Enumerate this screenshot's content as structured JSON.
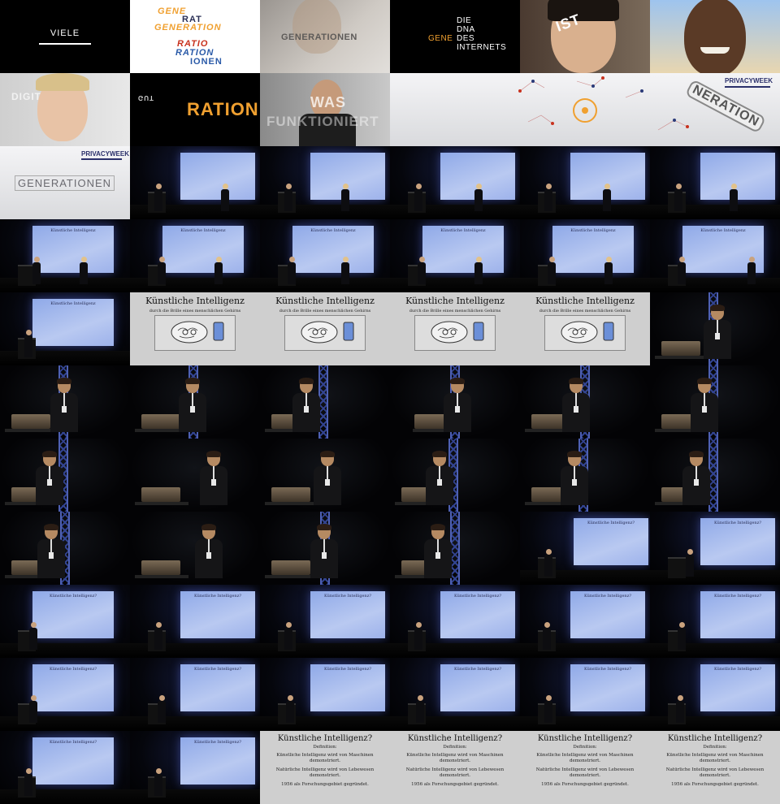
{
  "intro": {
    "viele": "VIELE",
    "generation_words": [
      "GENE",
      "RAT",
      "GENERATION",
      "RATIO",
      "RATION",
      "IONEN"
    ],
    "generationen": "GENERATIONEN",
    "dna_gene": "GENE",
    "dna_lines": [
      "DIE",
      "DNA",
      "DES",
      "INTERNETS"
    ],
    "ist_gut": "IST",
    "digital": "DIGITAL",
    "ration": "RATION",
    "was": "WAS",
    "funktioniert": "FUNKTIONIERT",
    "privacyweek": "PRIVACYWEEK",
    "neration": "NERATION",
    "generationen_gray": "GENERATIONEN"
  },
  "slide_ki": {
    "title": "Künstliche Intelligenz",
    "subtitle": "durch die Brille eines menschlichen Gehirns"
  },
  "slide_def": {
    "title": "Künstliche Intelligenz?",
    "label": "Definition:",
    "line1": "Künstliche Intelligenz wird von Maschinen",
    "line1b": "demonstriert.",
    "line2": "Natürliche Intelligenz wird von Lebewesen",
    "line2b": "demonstriert.",
    "line3": "1956 als Forschungsgebiet gegründet."
  },
  "colors": {
    "orange": "#f0a030",
    "blue_word": "#2a5aa8",
    "red_word": "#c8321e",
    "stage_screen": "#a9bcef"
  }
}
